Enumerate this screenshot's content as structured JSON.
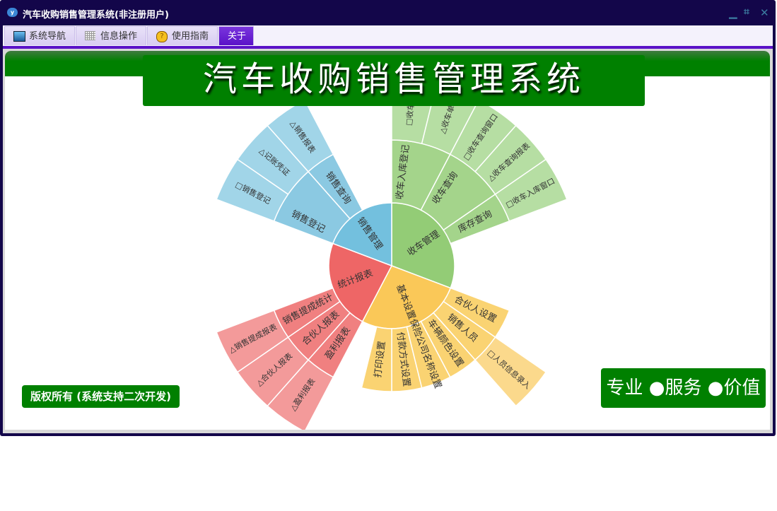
{
  "window": {
    "title": "汽车收购销售管理系统(非注册用户)",
    "icon": "app-logo-icon",
    "controls": [
      "minimize-icon",
      "restore-icon",
      "close-icon"
    ]
  },
  "tabs": [
    {
      "label": "系统导航",
      "icon": "monitor-icon"
    },
    {
      "label": "信息操作",
      "icon": "grid-icon"
    },
    {
      "label": "使用指南",
      "icon": "help-icon"
    },
    {
      "label": "关于",
      "active": true
    }
  ],
  "banner": {
    "title": "汽车收购销售管理系统"
  },
  "footer": {
    "copyright": "版权所有 (系统支持二次开发)",
    "slogan": "专业 ●服务 ●价值"
  },
  "sunburst": {
    "colors": {
      "green": [
        "#93cc76",
        "#a4d48b",
        "#b6dea3"
      ],
      "yellow": [
        "#fac858",
        "#fad372",
        "#fbd98c"
      ],
      "red": [
        "#ee6666",
        "#f08080",
        "#f39a9a"
      ],
      "blue": [
        "#73c0de",
        "#8bc9e2",
        "#a1d5e8"
      ]
    },
    "nodes": [
      {
        "name": "收车管理",
        "color": "green",
        "value": 8,
        "children": [
          {
            "name": "收车入库登记",
            "value": 2,
            "children": [
              {
                "name": "□收车入",
                "value": 1
              },
              {
                "name": "△收车单",
                "value": 1
              }
            ]
          },
          {
            "name": "收车查询",
            "value": 2,
            "children": [
              {
                "name": "□收车查询窗口",
                "value": 1
              },
              {
                "name": "△收车查询报表",
                "value": 1
              }
            ]
          },
          {
            "name": "库存查询",
            "value": 1,
            "children": [
              {
                "name": "□收车入库窗口",
                "value": 1
              }
            ]
          }
        ]
      },
      {
        "name": "基本设置",
        "color": "yellow",
        "value": 7,
        "children": [
          {
            "name": "合伙人设置",
            "value": 1
          },
          {
            "name": "销售人员",
            "value": 1,
            "children": [
              {
                "name": "□人员信息录入",
                "value": 1
              }
            ]
          },
          {
            "name": "车辆颜色设置",
            "value": 1
          },
          {
            "name": "保险公司名称设置",
            "value": 1
          },
          {
            "name": "付款方式设置",
            "value": 1
          },
          {
            "name": "打印设置",
            "value": 1
          }
        ]
      },
      {
        "name": "统计报表",
        "color": "red",
        "value": 6,
        "children": [
          {
            "name": "盈利报表",
            "value": 1,
            "children": [
              {
                "name": "△盈利报表",
                "value": 1
              }
            ]
          },
          {
            "name": "合伙人报表",
            "value": 1,
            "children": [
              {
                "name": "△合伙人报表",
                "value": 1
              }
            ]
          },
          {
            "name": "销售提成统计",
            "value": 1,
            "children": [
              {
                "name": "△销售提成报表",
                "value": 1
              }
            ]
          }
        ]
      },
      {
        "name": "销售管理",
        "color": "blue",
        "value": 5,
        "children": [
          {
            "name": "销售登记",
            "value": 2,
            "children": [
              {
                "name": "□销售登记",
                "value": 1
              },
              {
                "name": "△记账凭证",
                "value": 1
              }
            ]
          },
          {
            "name": "销售查询",
            "value": 1,
            "children": [
              {
                "name": "△销售报表",
                "value": 1
              }
            ]
          }
        ]
      }
    ]
  }
}
